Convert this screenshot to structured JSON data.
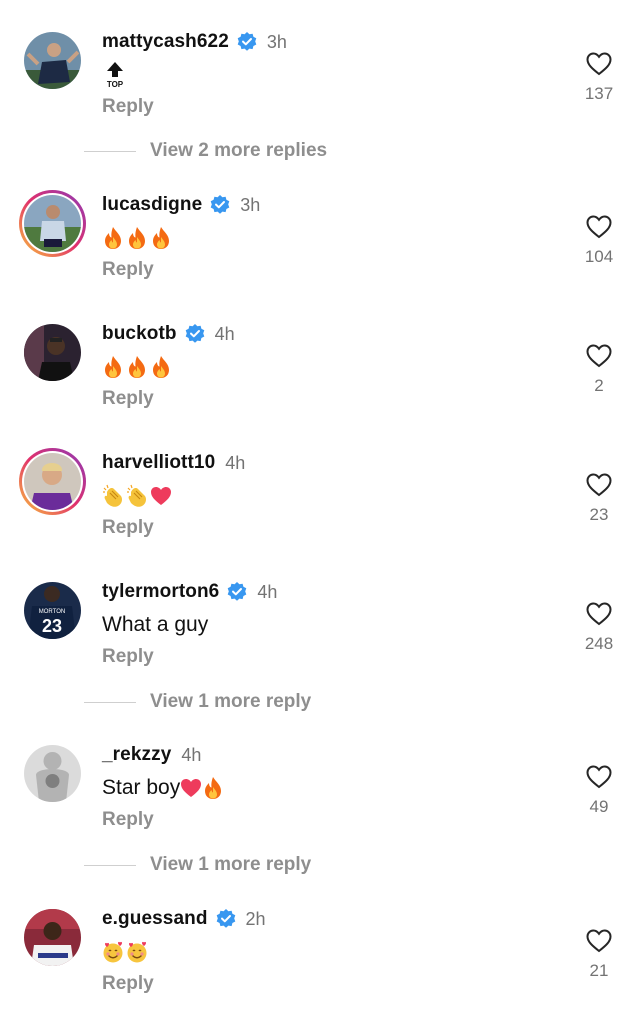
{
  "comments": [
    {
      "username": "mattycash622",
      "verified": true,
      "time": "3h",
      "text": "",
      "icon": "top-arrow-icon",
      "icon_label": "TOP",
      "reply": "Reply",
      "likes": "137"
    },
    {
      "username": "lucasdigne",
      "verified": true,
      "time": "3h",
      "emojis": [
        "fire-emoji",
        "fire-emoji",
        "fire-emoji"
      ],
      "reply": "Reply",
      "likes": "104"
    },
    {
      "username": "buckotb",
      "verified": true,
      "time": "4h",
      "emojis": [
        "fire-emoji",
        "fire-emoji",
        "fire-emoji"
      ],
      "reply": "Reply",
      "likes": "2"
    },
    {
      "username": "harvelliott10",
      "verified": false,
      "time": "4h",
      "emojis": [
        "clap-emoji",
        "clap-emoji",
        "heart-emoji"
      ],
      "reply": "Reply",
      "likes": "23"
    },
    {
      "username": "tylermorton6",
      "verified": true,
      "time": "4h",
      "text": "What a guy",
      "reply": "Reply",
      "likes": "248"
    },
    {
      "username": "_rekzzy",
      "verified": false,
      "time": "4h",
      "text": "Star boy",
      "emojis": [
        "heart-emoji",
        "fire-emoji"
      ],
      "reply": "Reply",
      "likes": "49"
    },
    {
      "username": "e.guessand",
      "verified": true,
      "time": "2h",
      "emojis": [
        "smiling-hearts-emoji",
        "smiling-hearts-emoji"
      ],
      "reply": "Reply",
      "likes": "21"
    }
  ],
  "view_more": [
    {
      "label": "View 2 more replies"
    },
    {
      "label": "View 1 more reply"
    },
    {
      "label": "View 1 more reply"
    }
  ],
  "colors": {
    "verified": "#3897f0",
    "muted": "#8e8e8e",
    "story_ring": "#e1306c"
  }
}
